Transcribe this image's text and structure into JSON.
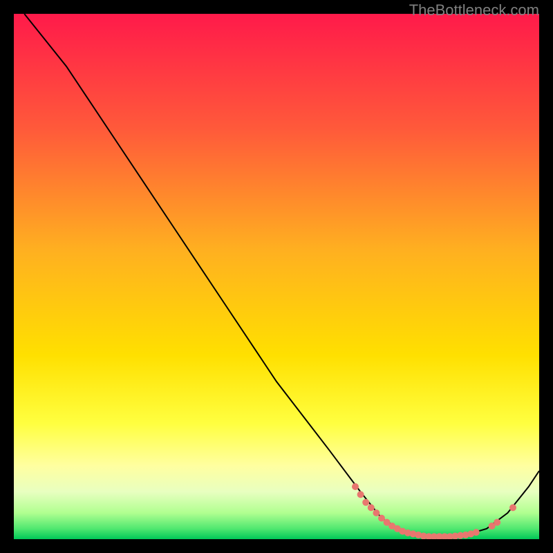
{
  "watermark": "TheBottleneck.com",
  "chart_data": {
    "type": "line",
    "title": "",
    "xlabel": "",
    "ylabel": "",
    "xlim": [
      0,
      100
    ],
    "ylim": [
      0,
      100
    ],
    "gradient_colors": {
      "top": "#ff1a4a",
      "upper_mid": "#ff8020",
      "mid": "#ffe000",
      "lower_mid": "#ffff60",
      "lower": "#e0ffb0",
      "bottom": "#00d060"
    },
    "curve": {
      "description": "Bottleneck curve starting high at left, descending steeply, reaching minimum around x=75-90, rising at far right",
      "points": [
        {
          "x": 2,
          "y": 100
        },
        {
          "x": 6,
          "y": 95
        },
        {
          "x": 10,
          "y": 90
        },
        {
          "x": 14,
          "y": 84
        },
        {
          "x": 20,
          "y": 75
        },
        {
          "x": 30,
          "y": 60
        },
        {
          "x": 40,
          "y": 45
        },
        {
          "x": 50,
          "y": 30
        },
        {
          "x": 60,
          "y": 17
        },
        {
          "x": 66,
          "y": 9
        },
        {
          "x": 70,
          "y": 4
        },
        {
          "x": 74,
          "y": 1.5
        },
        {
          "x": 78,
          "y": 0.5
        },
        {
          "x": 82,
          "y": 0.5
        },
        {
          "x": 86,
          "y": 0.8
        },
        {
          "x": 90,
          "y": 2
        },
        {
          "x": 94,
          "y": 5
        },
        {
          "x": 98,
          "y": 10
        },
        {
          "x": 100,
          "y": 13
        }
      ]
    },
    "markers": {
      "description": "Coral dots clustered along the bottom valley of the curve",
      "color": "#e8776f",
      "points": [
        {
          "x": 65,
          "y": 10
        },
        {
          "x": 66,
          "y": 8.5
        },
        {
          "x": 67,
          "y": 7
        },
        {
          "x": 68,
          "y": 6
        },
        {
          "x": 69,
          "y": 5
        },
        {
          "x": 70,
          "y": 4
        },
        {
          "x": 71,
          "y": 3.2
        },
        {
          "x": 72,
          "y": 2.5
        },
        {
          "x": 73,
          "y": 2
        },
        {
          "x": 74,
          "y": 1.5
        },
        {
          "x": 75,
          "y": 1.2
        },
        {
          "x": 76,
          "y": 1
        },
        {
          "x": 77,
          "y": 0.8
        },
        {
          "x": 78,
          "y": 0.6
        },
        {
          "x": 79,
          "y": 0.5
        },
        {
          "x": 80,
          "y": 0.5
        },
        {
          "x": 81,
          "y": 0.5
        },
        {
          "x": 82,
          "y": 0.5
        },
        {
          "x": 83,
          "y": 0.5
        },
        {
          "x": 84,
          "y": 0.6
        },
        {
          "x": 85,
          "y": 0.7
        },
        {
          "x": 86,
          "y": 0.8
        },
        {
          "x": 87,
          "y": 1
        },
        {
          "x": 88,
          "y": 1.3
        },
        {
          "x": 91,
          "y": 2.5
        },
        {
          "x": 92,
          "y": 3.2
        },
        {
          "x": 95,
          "y": 6
        }
      ]
    }
  }
}
